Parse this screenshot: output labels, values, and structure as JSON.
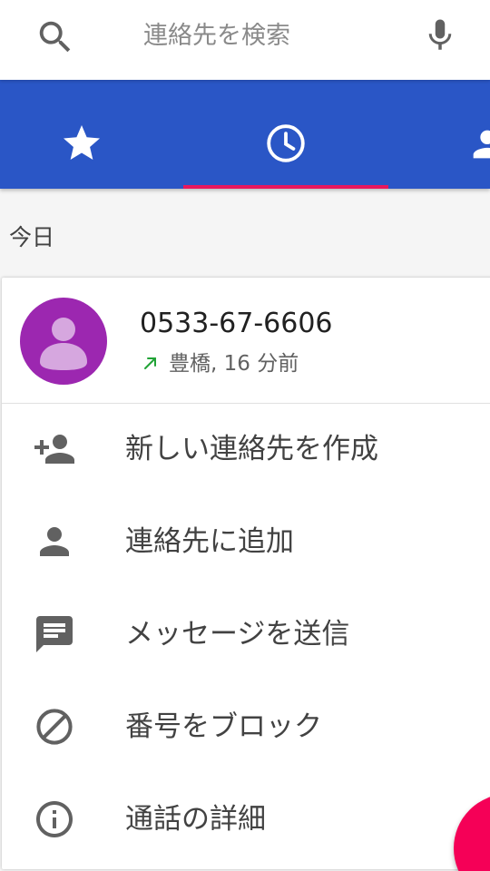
{
  "search": {
    "placeholder": "連絡先を検索",
    "search_icon": "search-icon",
    "mic_icon": "mic-icon"
  },
  "tabs": [
    {
      "name": "favorites",
      "icon": "star-icon"
    },
    {
      "name": "recent",
      "icon": "clock-icon",
      "selected": true
    },
    {
      "name": "contacts",
      "icon": "person-icon"
    }
  ],
  "colors": {
    "tab_bar": "#2a56c6",
    "tab_indicator": "#e8175d",
    "avatar": "#9c27b0",
    "fab": "#f50057",
    "outgoing_arrow": "#21a336"
  },
  "section": {
    "title": "今日"
  },
  "call": {
    "number": "0533-67-6606",
    "location": "豊橋, 16 分前",
    "direction_icon": "outgoing-call-arrow-icon"
  },
  "actions": [
    {
      "label": "新しい連絡先を作成",
      "icon": "person-add-icon"
    },
    {
      "label": "連絡先に追加",
      "icon": "person-icon"
    },
    {
      "label": "メッセージを送信",
      "icon": "message-icon"
    },
    {
      "label": "番号をブロック",
      "icon": "block-icon"
    },
    {
      "label": "通話の詳細",
      "icon": "info-icon"
    }
  ]
}
